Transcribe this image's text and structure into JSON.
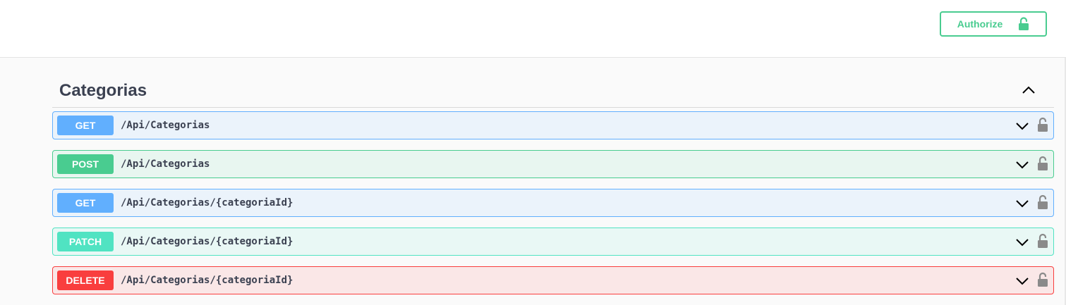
{
  "header": {
    "authorize_label": "Authorize",
    "authorize_icon": "lock-open-icon",
    "accent_color": "#49cc90"
  },
  "tag": {
    "title": "Categorias",
    "toggle_icon": "chevron-up-icon"
  },
  "operations": [
    {
      "method": "GET",
      "path": "/Api/Categorias",
      "color": "#61affe"
    },
    {
      "method": "POST",
      "path": "/Api/Categorias",
      "color": "#49cc90"
    },
    {
      "method": "GET",
      "path": "/Api/Categorias/{categoriaId}",
      "color": "#61affe"
    },
    {
      "method": "PATCH",
      "path": "/Api/Categorias/{categoriaId}",
      "color": "#50e3c2"
    },
    {
      "method": "DELETE",
      "path": "/Api/Categorias/{categoriaId}",
      "color": "#f93e3e"
    }
  ],
  "operation_icons": {
    "expand": "chevron-down-icon",
    "lock": "lock-icon"
  }
}
